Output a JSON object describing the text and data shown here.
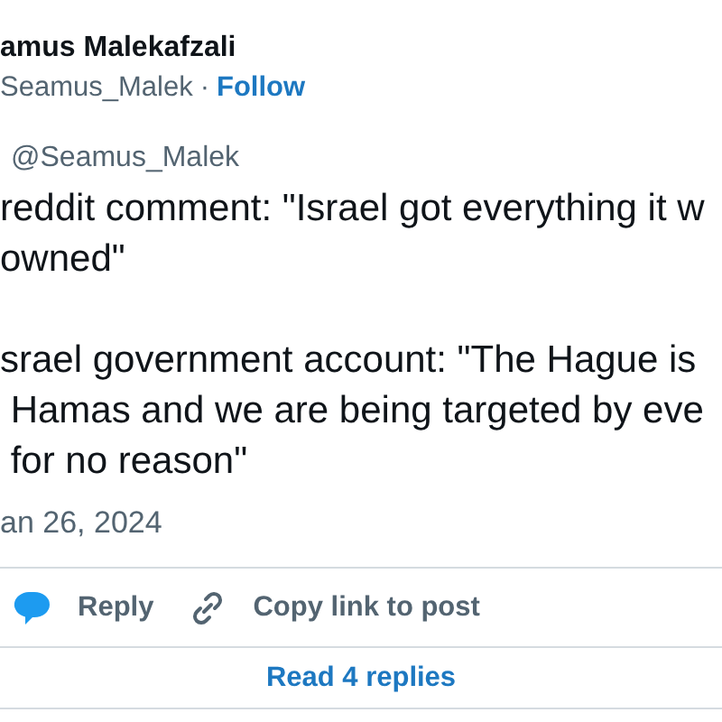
{
  "author": {
    "name": "amus Malekafzali",
    "handle": "Seamus_Malek",
    "separator": "·",
    "follow": "Follow"
  },
  "quoted_handle": "@Seamus_Malek",
  "body_paragraphs": [
    [
      "reddit comment: \"Israel got everything it w",
      "owned\""
    ],
    [
      "srael government account: \"The Hague is",
      " Hamas and we are being targeted by eve",
      " for no reason\""
    ]
  ],
  "date": "an 26, 2024",
  "actions": [
    {
      "kind": "reply",
      "label": "Reply"
    },
    {
      "kind": "link",
      "label": "Copy link to post"
    }
  ],
  "read_replies": "Read 4 replies"
}
